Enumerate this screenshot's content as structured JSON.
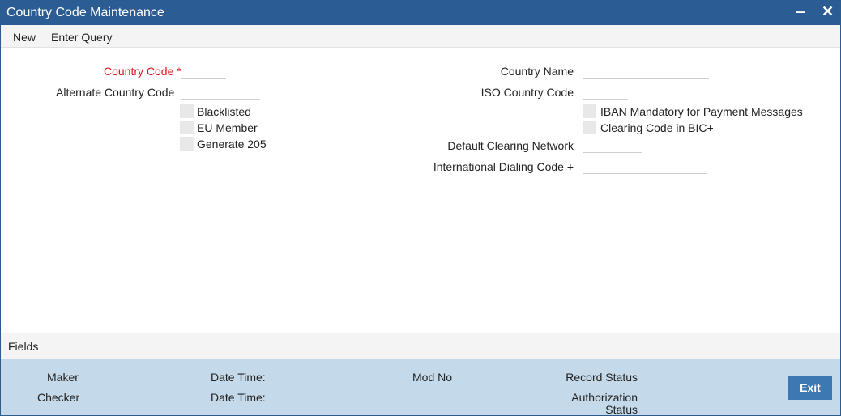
{
  "window": {
    "title": "Country Code Maintenance",
    "minimize_glyph": "‒",
    "close_glyph": "✕"
  },
  "menu": {
    "new": "New",
    "enter_query": "Enter Query"
  },
  "form": {
    "country_code": {
      "label": "Country Code",
      "required_mark": "*",
      "value": ""
    },
    "alternate_country_code": {
      "label": "Alternate Country Code",
      "value": ""
    },
    "blacklisted": {
      "label": "Blacklisted",
      "checked": false
    },
    "eu_member": {
      "label": "EU Member",
      "checked": false
    },
    "generate_205": {
      "label": "Generate 205",
      "checked": false
    },
    "country_name": {
      "label": "Country Name",
      "value": ""
    },
    "iso_country_code": {
      "label": "ISO Country Code",
      "value": ""
    },
    "iban_mandatory": {
      "label": "IBAN Mandatory for Payment Messages",
      "checked": false
    },
    "clearing_code_bic": {
      "label": "Clearing Code in BIC+",
      "checked": false
    },
    "default_clearing_network": {
      "label": "Default Clearing Network",
      "value": ""
    },
    "international_dialing_code": {
      "label": "International Dialing Code +",
      "value": ""
    }
  },
  "fields_section": {
    "label": "Fields"
  },
  "footer": {
    "maker": "Maker",
    "checker": "Checker",
    "date_time_1": "Date Time:",
    "date_time_2": "Date Time:",
    "mod_no": "Mod No",
    "record_status": "Record Status",
    "authorization_status_line1": "Authorization",
    "authorization_status_line2": "Status",
    "exit": "Exit"
  },
  "colors": {
    "titlebar": "#2b5c94",
    "required": "#e0141e",
    "footer": "#c4d9ea",
    "exit_button": "#3e78b3"
  }
}
